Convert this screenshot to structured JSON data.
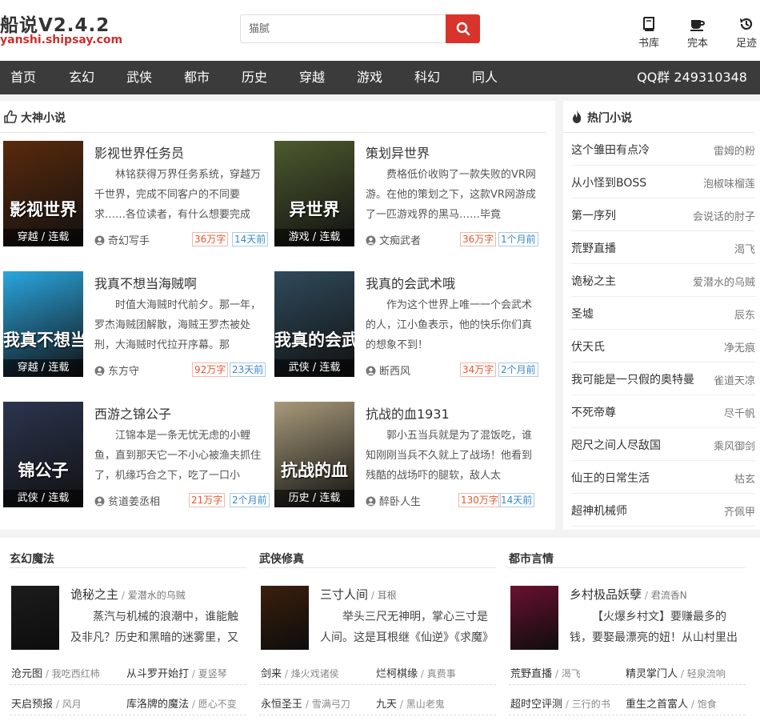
{
  "header": {
    "logo_title": "船说V2.4.2",
    "logo_url": "yanshi.shipsay.com",
    "search_placeholder": "猫腻",
    "tools": [
      {
        "label": "书库",
        "icon": "book-icon"
      },
      {
        "label": "完本",
        "icon": "cup-icon"
      },
      {
        "label": "足迹",
        "icon": "history-icon"
      }
    ]
  },
  "nav": {
    "items": [
      "首页",
      "玄幻",
      "武侠",
      "都市",
      "历史",
      "穿越",
      "游戏",
      "科幻",
      "同人"
    ],
    "qq": "QQ群 249310348"
  },
  "featured": {
    "title": "大神小说",
    "books": [
      {
        "title": "影视世界任务员",
        "desc": "林铭获得万界任务系统，穿越万千世界，完成不同客户的不同要求……各位读者，有什么想要完成",
        "tag": "穿越 / 连载",
        "author": "奇幻写手",
        "words": "36万字",
        "time": "14天前",
        "cover_text": "影视世界",
        "cover_bg": "#5a2a0c"
      },
      {
        "title": "策划异世界",
        "desc": "费格低价收购了一款失败的VR网游。在他的策划之下，这款VR网游成了一匹游戏界的黑马……毕竟",
        "tag": "游戏 / 连载",
        "author": "文痴武者",
        "words": "36万字",
        "time": "1个月前",
        "cover_text": "异世界",
        "cover_bg": "#4d5a2e"
      },
      {
        "title": "我真不想当海贼啊",
        "desc": "时值大海贼时代前夕。那一年，罗杰海贼团解散，海贼王罗杰被处刑，大海贼时代拉开序幕。那",
        "tag": "穿越 / 连载",
        "author": "东方守",
        "words": "92万字",
        "time": "23天前",
        "cover_text": "我真不想当",
        "cover_bg": "#2aa6e0"
      },
      {
        "title": "我真的会武术哦",
        "desc": "作为这个世界上唯一一个会武术的人，江小鱼表示，他的快乐你们真的想象不到！",
        "tag": "武侠 / 连载",
        "author": "断西风",
        "words": "34万字",
        "time": "2个月前",
        "cover_text": "我真的会武术",
        "cover_bg": "#2f4a5c"
      },
      {
        "title": "西游之锦公子",
        "desc": "江锦本是一条无忧无虑的小鲤鱼，直到那天它一不小心被渔夫抓住了，机缘巧合之下，吃了一口小",
        "tag": "武侠 / 连载",
        "author": "贫道姜丞相",
        "words": "21万字",
        "time": "2个月前",
        "cover_text": "锦公子",
        "cover_bg": "#2c3550"
      },
      {
        "title": "抗战的血1931",
        "desc": "郭小五当兵就是为了混饭吃，谁知刚刚当兵不久就上了战场！他看到残酷的战场吓的腿软，敌人太",
        "tag": "历史 / 连载",
        "author": "醉卧人生",
        "words": "130万字",
        "time": "14天前",
        "cover_text": "抗战的血",
        "cover_bg": "#a89a7a"
      }
    ]
  },
  "hot": {
    "title": "热门小说",
    "items": [
      {
        "title": "这个雏田有点冷",
        "author": "雷姆的粉"
      },
      {
        "title": "从小怪到BOSS",
        "author": "泡椒味榴莲"
      },
      {
        "title": "第一序列",
        "author": "会说话的肘子"
      },
      {
        "title": "荒野直播",
        "author": "渴飞"
      },
      {
        "title": "诡秘之主",
        "author": "爱潜水的乌贼"
      },
      {
        "title": "圣墟",
        "author": "辰东"
      },
      {
        "title": "伏天氏",
        "author": "净无痕"
      },
      {
        "title": "我可能是一只假的奥特曼",
        "author": "雀道天凉"
      },
      {
        "title": "不死帝尊",
        "author": "尽千帆"
      },
      {
        "title": "咫尺之间人尽敌国",
        "author": "乘风御剑"
      },
      {
        "title": "仙王的日常生活",
        "author": "枯玄"
      },
      {
        "title": "超神机械师",
        "author": "齐佩甲"
      }
    ]
  },
  "categories": [
    {
      "name": "玄幻魔法",
      "top": {
        "title": "诡秘之主",
        "author": "爱潜水的乌贼",
        "desc": "蒸汽与机械的浪潮中，谁能触及非凡？历史和黑暗的迷雾里，又是",
        "cover_bg": "#1c1c1c"
      },
      "rows": [
        [
          {
            "title": "沧元图",
            "author": "我吃西红柿"
          },
          {
            "title": "从斗罗开始打",
            "author": "夏竖琴"
          }
        ],
        [
          {
            "title": "天启预报",
            "author": "风月"
          },
          {
            "title": "库洛牌的魔法",
            "author": "愿心不变"
          }
        ]
      ]
    },
    {
      "name": "武侠修真",
      "top": {
        "title": "三寸人间",
        "author": "耳根",
        "desc": "举头三尺无神明，掌心三寸是人间。这是耳根继《仙逆》《求魔》",
        "cover_bg": "#3b1f0c"
      },
      "rows": [
        [
          {
            "title": "剑来",
            "author": "烽火戏诸侯"
          },
          {
            "title": "烂柯棋缘",
            "author": "真费事"
          }
        ],
        [
          {
            "title": "永恒圣王",
            "author": "雪满弓刀"
          },
          {
            "title": "九天",
            "author": "黑山老鬼"
          }
        ]
      ]
    },
    {
      "name": "都市言情",
      "top": {
        "title": "乡村极品妖孽",
        "author": "君流香N",
        "desc": "【火爆乡村文】要赚最多的钱，要娶最漂亮的妞！从山村里出来的",
        "cover_bg": "#6a1030"
      },
      "rows": [
        [
          {
            "title": "荒野直播",
            "author": "渴飞"
          },
          {
            "title": "精灵掌门人",
            "author": "轻泉流响"
          }
        ],
        [
          {
            "title": "超时空评测",
            "author": "三行的书"
          },
          {
            "title": "重生之首富人",
            "author": "饱食"
          }
        ]
      ]
    }
  ],
  "colors": {
    "accent": "#d9342b",
    "nav_bg": "#3b3b3b",
    "tag_red": "#e4572e",
    "tag_blue": "#3a87c8"
  }
}
